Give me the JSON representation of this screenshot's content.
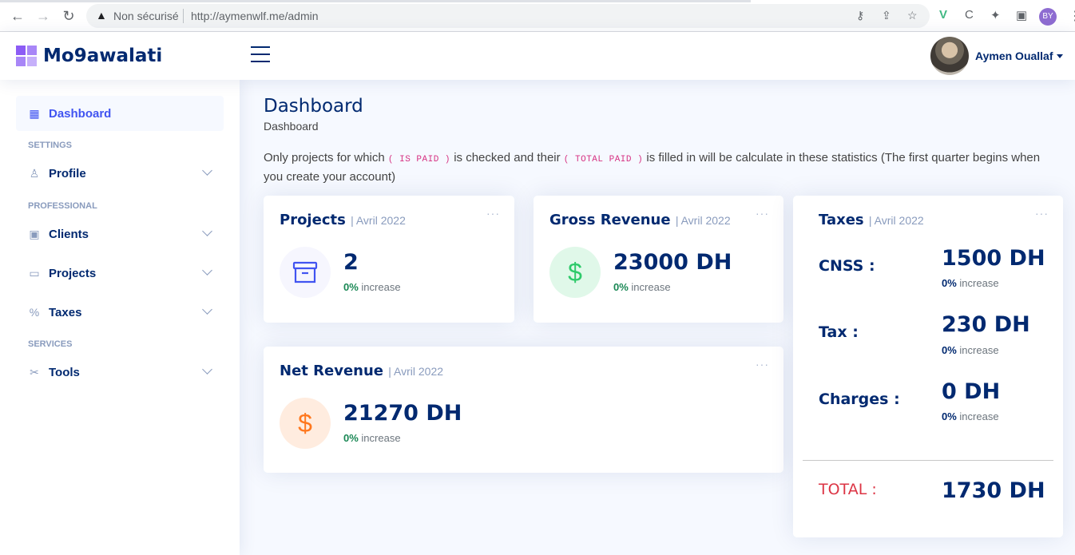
{
  "browser": {
    "security_label": "Non sécurisé",
    "url": "http://aymenwlf.me/admin",
    "profile_initials": "BY"
  },
  "app": {
    "brand": "Mo9awalati",
    "user_name": "Aymen Ouallaf"
  },
  "sidebar": {
    "dashboard": "Dashboard",
    "heading_settings": "SETTINGS",
    "profile": "Profile",
    "heading_professional": "PROFESSIONAL",
    "clients": "Clients",
    "projects": "Projects",
    "taxes": "Taxes",
    "heading_services": "SERVICES",
    "tools": "Tools"
  },
  "page": {
    "title": "Dashboard",
    "breadcrumb": "Dashboard",
    "notice_1": "Only projects for which",
    "notice_code_1": "( IS PAID )",
    "notice_2": "is checked and their",
    "notice_code_2": "( TOTAL PAID )",
    "notice_3": "is filled in will be calculate in these statistics (The first quarter begins when you create your account)"
  },
  "cards": {
    "period": "| Avril 2022",
    "increase_pct": "0%",
    "increase_word": "increase",
    "more": "···",
    "projects": {
      "title": "Projects",
      "value": "2"
    },
    "gross": {
      "title": "Gross Revenue",
      "value": "23000 DH"
    },
    "net": {
      "title": "Net Revenue",
      "value": "21270 DH"
    },
    "taxes": {
      "title": "Taxes",
      "cnss_label": "CNSS :",
      "cnss_value": "1500 DH",
      "tax_label": "Tax :",
      "tax_value": "230 DH",
      "charges_label": "Charges :",
      "charges_value": "0 DH",
      "total_label": "TOTAL :",
      "total_value": "1730 DH"
    }
  },
  "colors": {
    "primary": "#4154f1",
    "dark_blue": "#012970",
    "success": "#198754",
    "total_red": "#dc3545",
    "logo_purple": "#8c5cf5"
  }
}
